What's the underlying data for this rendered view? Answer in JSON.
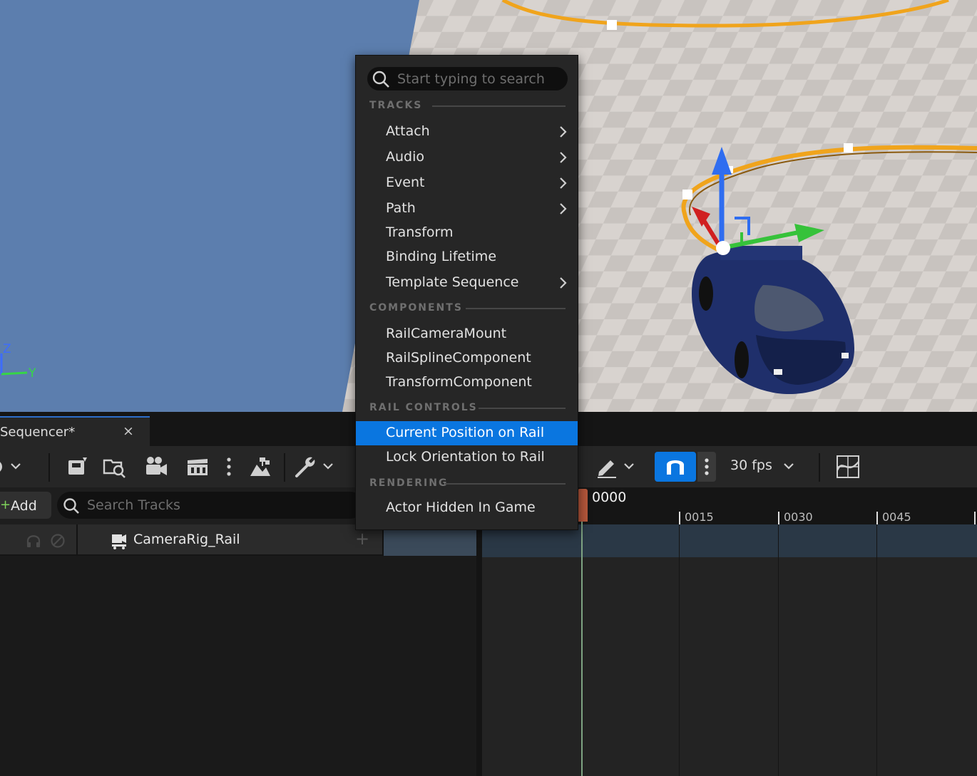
{
  "viewport": {
    "axis_z": "Z",
    "axis_y": "Y"
  },
  "sequencer": {
    "tab_title": "Sequencer*",
    "tab_close": "×",
    "toolbar": {
      "fps": "30 fps"
    },
    "add_button": "Add",
    "add_plus": "+",
    "search_tracks_placeholder": "Search Tracks",
    "track": {
      "name": "CameraRig_Rail",
      "add": "+"
    },
    "timeline": {
      "playhead": "0000",
      "ticks": [
        "0015",
        "0030",
        "0045"
      ]
    }
  },
  "context_menu": {
    "search_placeholder": "Start typing to search",
    "sections": {
      "tracks": "TRACKS",
      "components": "COMPONENTS",
      "rail_controls": "RAIL CONTROLS",
      "rendering": "RENDERING"
    },
    "tracks": [
      "Attach",
      "Audio",
      "Event",
      "Path",
      "Transform",
      "Binding Lifetime",
      "Template Sequence"
    ],
    "components": [
      "RailCameraMount",
      "RailSplineComponent",
      "TransformComponent"
    ],
    "rail_controls": [
      "Current Position on Rail",
      "Lock Orientation to Rail"
    ],
    "rendering": [
      "Actor Hidden In Game"
    ]
  },
  "colors": {
    "accent": "#0a76e0",
    "rail": "#f0a41c",
    "car": "#1f2f6b"
  }
}
